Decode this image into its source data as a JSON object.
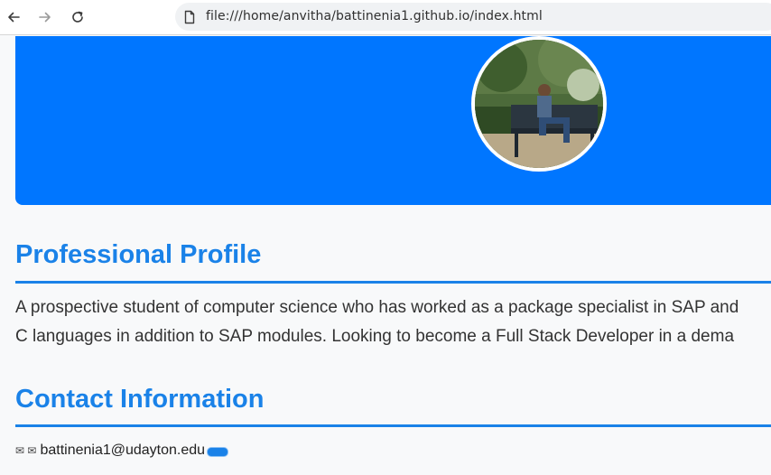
{
  "browser": {
    "url": "file:///home/anvitha/battinenia1.github.io/index.html",
    "icons": [
      "back-arrow-icon",
      "forward-arrow-icon",
      "reload-icon",
      "file-icon"
    ]
  },
  "hero": {
    "background_color": "#0076ff",
    "avatar_description_icon": "profile-photo"
  },
  "profile": {
    "title": "Professional Profile",
    "line1": "A prospective student of computer science who has worked as a package specialist in SAP and",
    "line2": "C languages in addition to SAP modules. Looking to become a Full Stack Developer in a dema"
  },
  "contact": {
    "title": "Contact Information",
    "icons": "✉ ✉",
    "email": "battinenia1@udayton.edu"
  },
  "colors": {
    "accent": "#1a82e8",
    "hero": "#0076ff",
    "text": "#333333"
  }
}
